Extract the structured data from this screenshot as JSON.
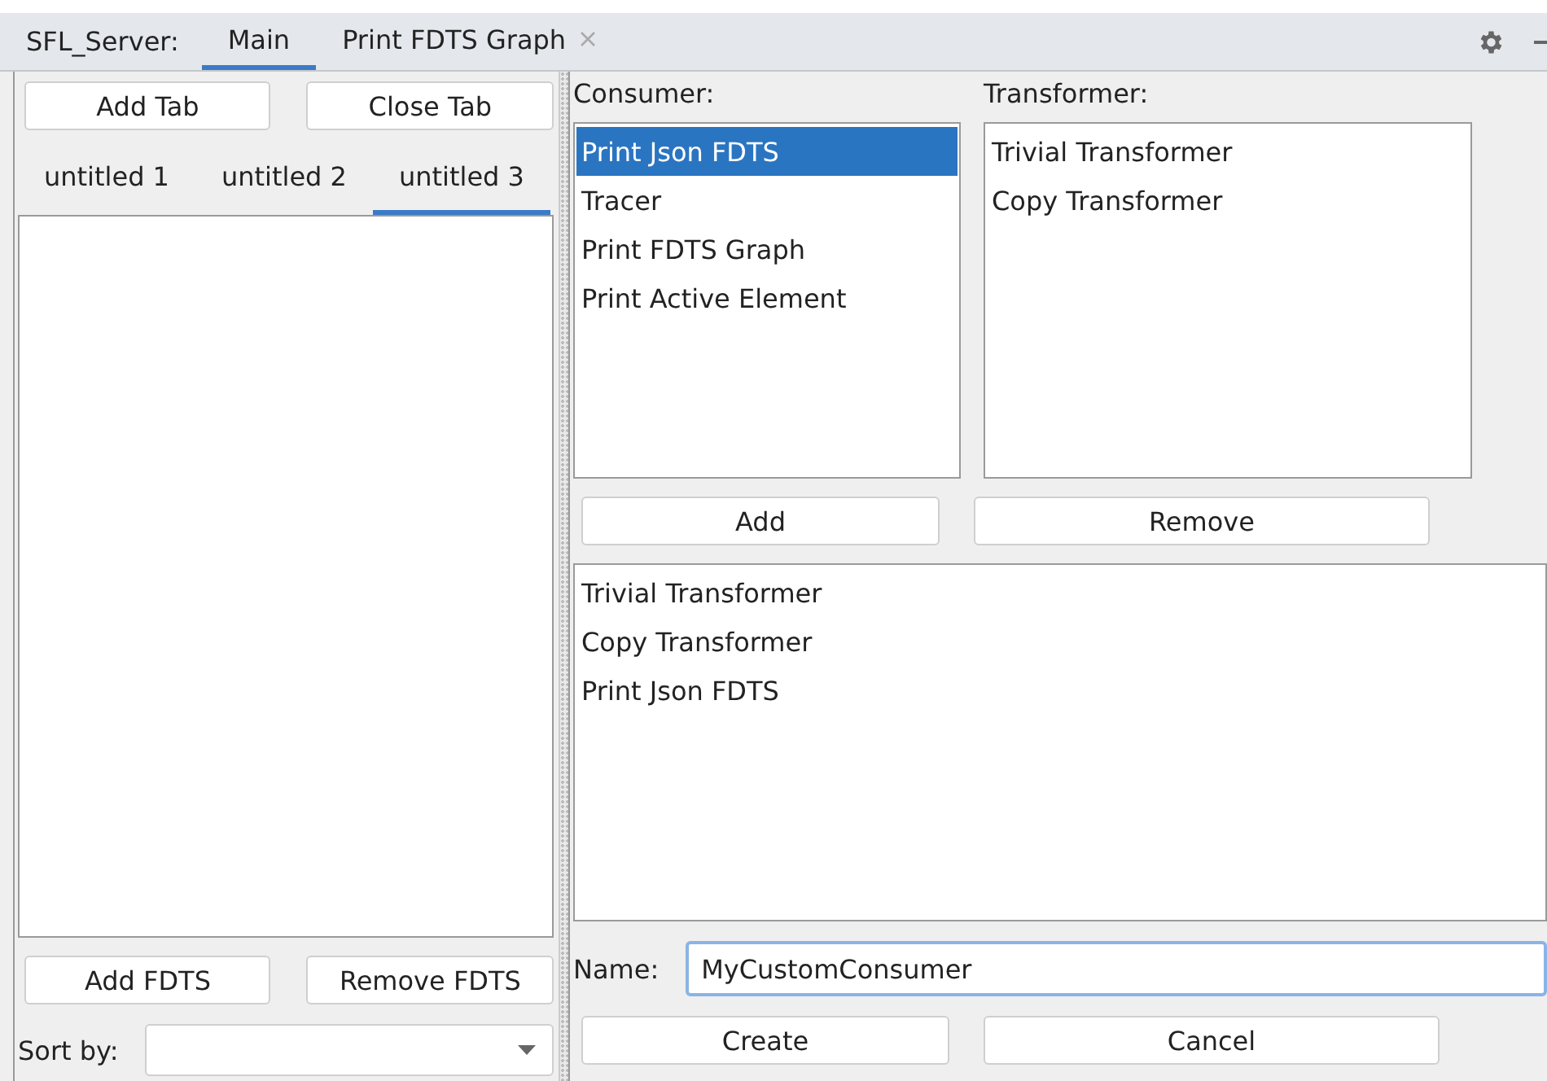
{
  "header": {
    "app_label": "SFL_Server:",
    "tabs": [
      {
        "label": "Main",
        "selected": true,
        "closable": false
      },
      {
        "label": "Print FDTS Graph",
        "selected": false,
        "closable": true
      }
    ]
  },
  "left": {
    "buttons": [
      "Add Tab",
      "Close Tab"
    ],
    "tabs": [
      {
        "label": "untitled 1",
        "selected": false
      },
      {
        "label": "untitled 2",
        "selected": false
      },
      {
        "label": "untitled 3",
        "selected": true
      }
    ],
    "bottom_buttons": [
      "Add FDTS",
      "Remove FDTS"
    ],
    "sort_label": "Sort by:"
  },
  "right": {
    "consumer_label": "Consumer:",
    "consumers": [
      {
        "label": "Print Json FDTS",
        "selected": true
      },
      {
        "label": "Tracer",
        "selected": false
      },
      {
        "label": "Print FDTS Graph",
        "selected": false
      },
      {
        "label": "Print Active Element",
        "selected": false
      }
    ],
    "transformer_label": "Transformer:",
    "transformers": [
      {
        "label": "Trivial Transformer",
        "selected": false
      },
      {
        "label": "Copy Transformer",
        "selected": false
      }
    ],
    "list_buttons": [
      "Add",
      "Remove"
    ],
    "chain": [
      "Trivial Transformer",
      "Copy Transformer",
      "Print Json FDTS"
    ],
    "name_label": "Name:",
    "name_value": "MyCustomConsumer",
    "action_buttons": [
      "Create",
      "Cancel"
    ]
  }
}
